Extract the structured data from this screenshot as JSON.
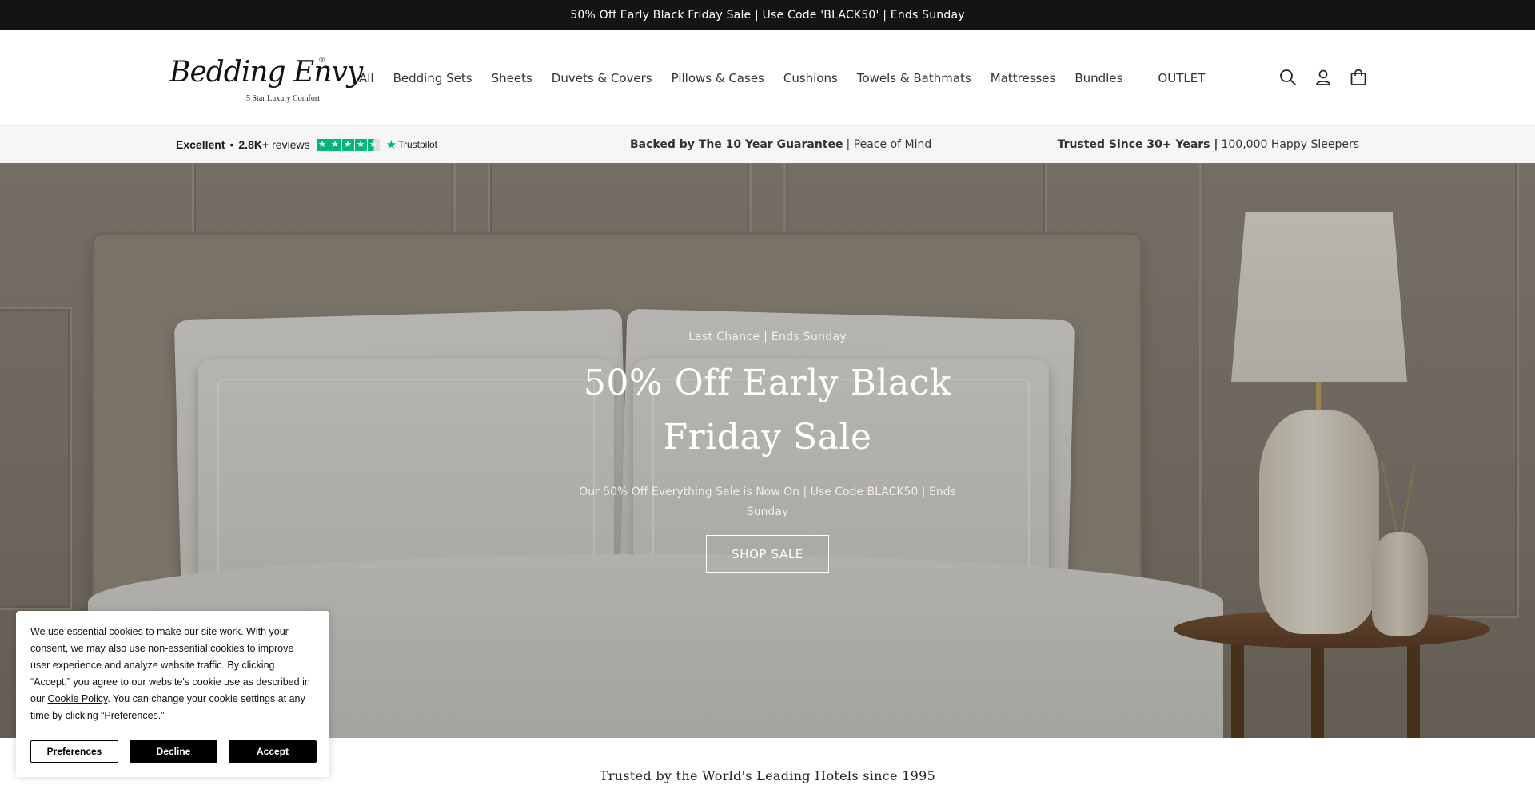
{
  "announcement": "50% Off Early Black Friday Sale | Use Code 'BLACK50' | Ends Sunday",
  "logo": {
    "script": "Bedding Envy",
    "registered": "®",
    "tagline": "5 Star Luxury Comfort"
  },
  "nav": {
    "items": [
      "All",
      "Bedding Sets",
      "Sheets",
      "Duvets & Covers",
      "Pillows & Cases",
      "Cushions",
      "Towels & Bathmats",
      "Mattresses",
      "Bundles"
    ],
    "outlet": "OUTLET"
  },
  "header_icons": [
    "search-icon",
    "account-icon",
    "cart-icon"
  ],
  "trustbar": {
    "trustpilot": {
      "rating_word": "Excellent",
      "separator": "•",
      "count": "2.8K+",
      "reviews_word": "reviews",
      "brand": "Trustpilot",
      "stars": 4.5
    },
    "guarantee": {
      "bold": "Backed by The 10 Year Guarantee",
      "rest": "| Peace of Mind"
    },
    "trusted": {
      "bold": "Trusted Since 30+ Years |",
      "rest": "100,000 Happy Sleepers"
    }
  },
  "hero": {
    "eyebrow": "Last Chance | Ends Sunday",
    "title": "50% Off Early Black Friday Sale",
    "subtitle": "Our 50% Off Everything Sale is Now On | Use Code BLACK50 | Ends Sunday",
    "button": "SHOP SALE"
  },
  "below_hero": "Trusted by the World's Leading Hotels since 1995",
  "cookie": {
    "text_before": "We use essential cookies to make our site work. With your consent, we may also use non-essential cookies to improve user experience and analyze website traffic. By clicking “Accept,” you agree to our website's cookie use as described in our ",
    "policy_link": "Cookie Policy",
    "text_middle": ". You can change your cookie settings at any time by clicking “",
    "prefs_link": "Preferences",
    "text_after": ".”",
    "buttons": {
      "preferences": "Preferences",
      "decline": "Decline",
      "accept": "Accept"
    }
  },
  "colors": {
    "announcement_bg": "#141414",
    "trustpilot_green": "#00b67a",
    "trustbar_bg": "#f6f6f6"
  }
}
